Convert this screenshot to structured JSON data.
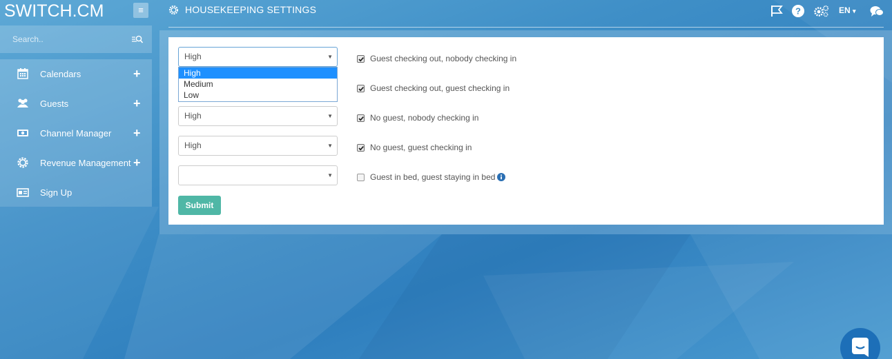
{
  "app": {
    "logo": "SWITCH.CM"
  },
  "sidebar": {
    "search_placeholder": "Search..",
    "items": [
      {
        "label": "Calendars",
        "icon": "calendar-icon",
        "expandable": "+"
      },
      {
        "label": "Guests",
        "icon": "users-icon",
        "expandable": "+"
      },
      {
        "label": "Channel Manager",
        "icon": "money-icon",
        "expandable": "+"
      },
      {
        "label": "Revenue Management",
        "icon": "gear-icon",
        "expandable": "+"
      },
      {
        "label": "Sign Up",
        "icon": "id-card-icon"
      }
    ]
  },
  "header": {
    "title": "HOUSEKEEPING SETTINGS",
    "language": "EN",
    "icons": [
      "flag-icon",
      "help-icon",
      "settings-icon",
      "chat-icon"
    ]
  },
  "form": {
    "rows": [
      {
        "priority": "High",
        "checked": true,
        "label": "Guest checking out, nobody checking in"
      },
      {
        "priority": "High",
        "checked": true,
        "label": "Guest checking out, guest checking in"
      },
      {
        "priority": "High",
        "checked": true,
        "label": "No guest, nobody checking in"
      },
      {
        "priority": "High",
        "checked": true,
        "label": "No guest, guest checking in"
      },
      {
        "priority": "",
        "checked": false,
        "label": "Guest in bed, guest staying in bed"
      }
    ],
    "dropdown_options": [
      "High",
      "Medium",
      "Low"
    ],
    "dropdown_selected": "High",
    "submit_label": "Submit"
  },
  "colors": {
    "submit": "#4fb7a6",
    "dropdown_highlight": "#1e90ff",
    "chat_widget": "#1d6fb8"
  }
}
